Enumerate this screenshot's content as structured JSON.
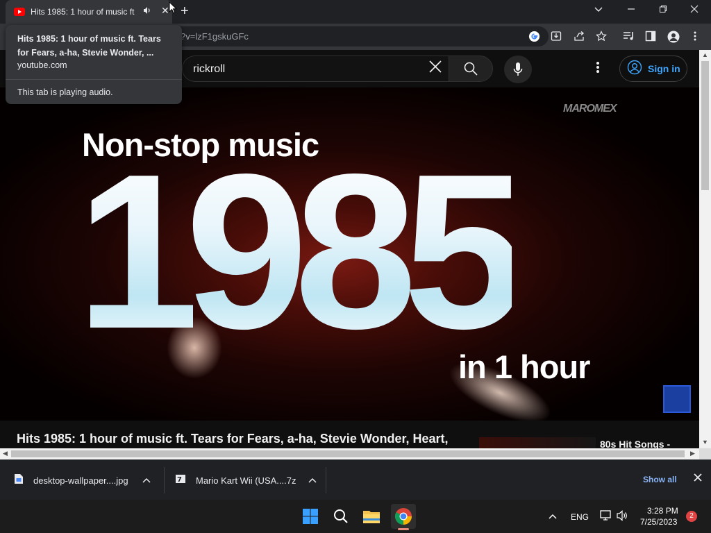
{
  "browser": {
    "tab": {
      "title": "Hits 1985: 1 hour of music ft.",
      "audio_icon": "speaker-icon",
      "close_icon": "close-icon"
    },
    "new_tab_icon": "plus-icon",
    "window_controls": [
      "chevron-down-icon",
      "minimize-icon",
      "restore-icon",
      "close-icon"
    ],
    "address": {
      "url_visible": "?v=lzF1gskuGFc"
    },
    "toolbar_icons": [
      "google-icon",
      "install-icon",
      "share-icon",
      "bookmark-star-icon",
      "media-control-icon",
      "side-panel-icon",
      "profile-icon",
      "more-vert-icon"
    ]
  },
  "hover_card": {
    "title": "Hits 1985: 1 hour of music ft. Tears for Fears, a-ha, Stevie Wonder, ...",
    "domain": "youtube.com",
    "status": "This tab is playing audio."
  },
  "youtube": {
    "search": {
      "query": "rickroll"
    },
    "signin_label": "Sign in",
    "video": {
      "brand": "MAROMEX",
      "line1": "Non-stop music",
      "big": "1985",
      "line3": "in 1 hour"
    },
    "video_title": "Hits 1985: 1 hour of music ft. Tears for Fears, a-ha, Stevie Wonder, Heart,",
    "recommended": {
      "title": "80s Hit Songs -"
    }
  },
  "downloads": {
    "items": [
      {
        "name": "desktop-wallpaper....jpg",
        "icon": "image-file-icon"
      },
      {
        "name": "Mario Kart Wii (USA....7z",
        "icon": "archive-file-icon"
      }
    ],
    "show_all": "Show all"
  },
  "taskbar": {
    "lang": "ENG",
    "time": "3:28 PM",
    "date": "7/25/2023",
    "notification_count": "2"
  },
  "colors": {
    "accent_link": "#3ea6ff",
    "show_all": "#8ab4f8",
    "yt_red": "#ff0000"
  }
}
